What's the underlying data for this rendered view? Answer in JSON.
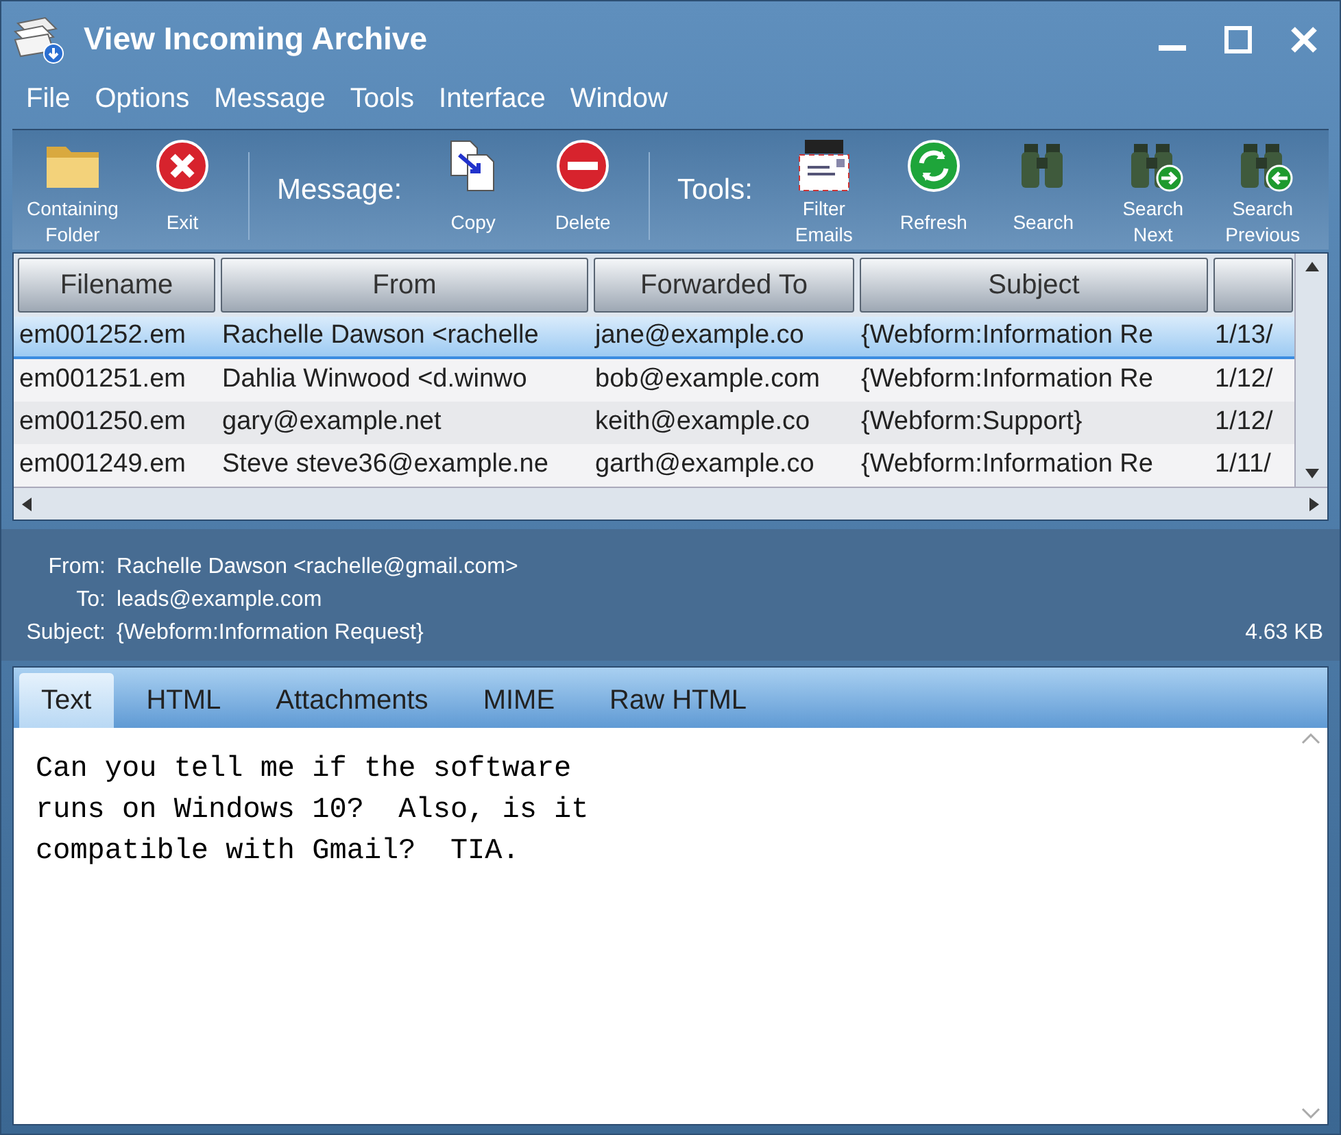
{
  "window": {
    "title": "View Incoming Archive"
  },
  "menu": [
    "File",
    "Options",
    "Message",
    "Tools",
    "Interface",
    "Window"
  ],
  "toolbar": [
    {
      "kind": "folder",
      "label": "Containing Folder"
    },
    {
      "kind": "exit",
      "label": "Exit"
    },
    {
      "kind": "separator"
    },
    {
      "kind": "label",
      "label": "Message:"
    },
    {
      "kind": "copy",
      "label": "Copy"
    },
    {
      "kind": "delete",
      "label": "Delete"
    },
    {
      "kind": "separator"
    },
    {
      "kind": "label",
      "label": "Tools:"
    },
    {
      "kind": "filter",
      "label": "Filter Emails"
    },
    {
      "kind": "refresh",
      "label": "Refresh"
    },
    {
      "kind": "search",
      "label": "Search"
    },
    {
      "kind": "next",
      "label": "Search Next"
    },
    {
      "kind": "previous",
      "label": "Search Previous"
    }
  ],
  "table": {
    "columns": [
      "Filename",
      "From",
      "Forwarded To",
      "Subject",
      ""
    ],
    "rows": [
      {
        "selected": true,
        "cells": [
          "em001252.em",
          "Rachelle Dawson <rachelle",
          "jane@example.co",
          "{Webform:Information Re",
          "1/13/"
        ]
      },
      {
        "selected": false,
        "cells": [
          "em001251.em",
          "Dahlia Winwood <d.winwo",
          "bob@example.com",
          "{Webform:Information Re",
          "1/12/"
        ]
      },
      {
        "selected": false,
        "cells": [
          "em001250.em",
          "gary@example.net",
          "keith@example.co",
          "{Webform:Support}",
          "1/12/"
        ]
      },
      {
        "selected": false,
        "cells": [
          "em001249.em",
          "Steve steve36@example.ne",
          "garth@example.co",
          "{Webform:Information Re",
          "1/11/"
        ]
      }
    ]
  },
  "message": {
    "fields": [
      {
        "label": "From:",
        "value": "Rachelle Dawson <rachelle@gmail.com>"
      },
      {
        "label": "To:",
        "value": "leads@example.com"
      },
      {
        "label": "Subject:",
        "value": "{Webform:Information Request}"
      }
    ],
    "size": "4.63 KB"
  },
  "tabs": [
    {
      "label": "Text",
      "selected": true
    },
    {
      "label": "HTML",
      "selected": false
    },
    {
      "label": "Attachments",
      "selected": false
    },
    {
      "label": "MIME",
      "selected": false
    },
    {
      "label": "Raw HTML",
      "selected": false
    }
  ],
  "body": [
    "Can you tell me if the software",
    "runs on Windows 10?  Also, is it",
    "compatible with Gmail?  TIA."
  ]
}
